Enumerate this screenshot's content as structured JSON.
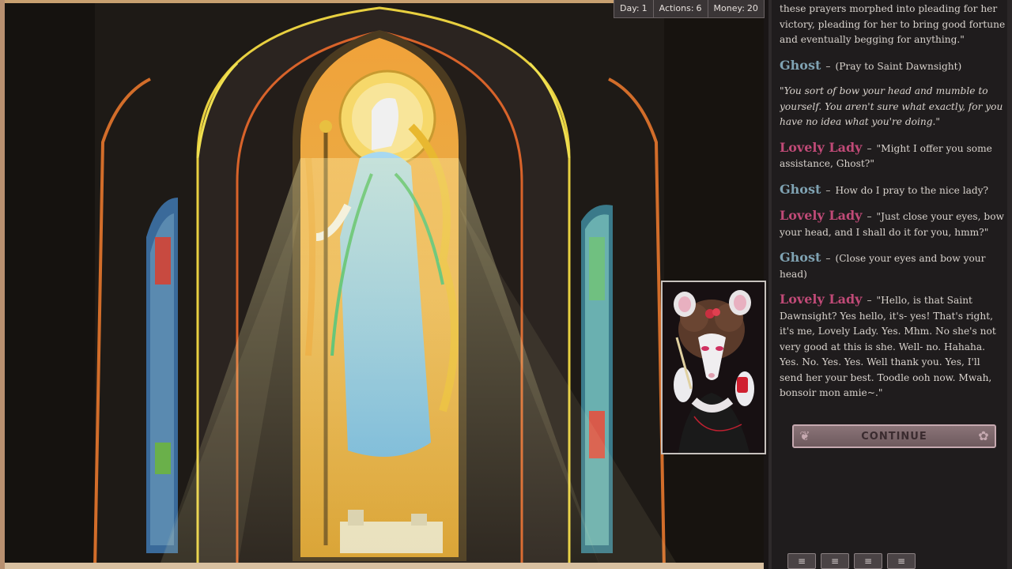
{
  "stats": {
    "day_label": "Day:",
    "day_value": "1",
    "actions_label": "Actions:",
    "actions_value": "6",
    "money_label": "Money:",
    "money_value": "20"
  },
  "log": {
    "intro": "these prayers morphed into pleading for her victory, pleading for her to bring good fortune and eventually begging for anything.\"",
    "entries": [
      {
        "speaker": "Ghost",
        "text": "(Pray to Saint Dawnsight)"
      },
      {
        "speaker": "",
        "text": "\"You sort of bow your head and mumble to yourself. You aren't sure what exactly, for you have no idea what you're doing.\""
      },
      {
        "speaker": "Lovely Lady",
        "text": "\"Might I offer you some assistance, Ghost?\""
      },
      {
        "speaker": "Ghost",
        "text": "How do I pray to the nice lady?"
      },
      {
        "speaker": "Lovely Lady",
        "text": "\"Just close your eyes, bow your head, and I shall do it for you, hmm?\""
      },
      {
        "speaker": "Ghost",
        "text": "(Close your eyes and bow your head)"
      },
      {
        "speaker": "Lovely Lady",
        "text": "\"Hello, is that Saint Dawnsight? Yes hello, it's- yes! That's right, it's me, Lovely Lady. Yes. Mhm. No she's not very good at this is she. Well- no. Hahaha. Yes. No. Yes. Yes. Well thank you. Yes, I'll send her your best. Toodle ooh now. Mwah, bonsoir mon amie~.\""
      }
    ],
    "separator": "–"
  },
  "continue_label": "CONTINUE",
  "menu_icon": "≡",
  "colors": {
    "ghost": "#7fa2b2",
    "lady": "#c04a77",
    "panel_bg": "#1f1c1d"
  }
}
